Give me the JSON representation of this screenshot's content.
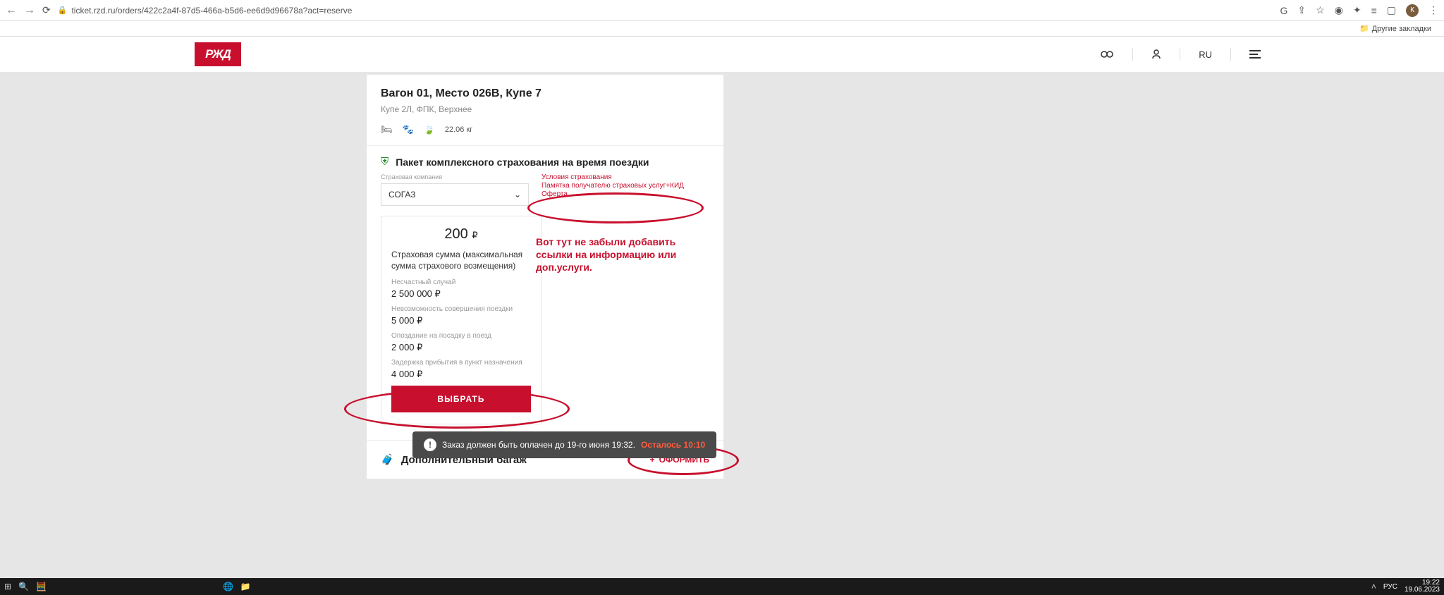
{
  "browser": {
    "url": "ticket.rzd.ru/orders/422c2a4f-87d5-466a-b5d6-ee6d9d96678a?act=reserve",
    "bookmarks_label": "Другие закладки",
    "avatar_letter": "К"
  },
  "header": {
    "logo": "РЖД",
    "lang": "RU"
  },
  "seat": {
    "title": "Вагон 01, Место 026В, Купе 7",
    "subtitle": "Купе 2Л, ФПК, Верхнее",
    "weight": "22.06 кг"
  },
  "insurance": {
    "section_title": "Пакет комплексного страхования на время поездки",
    "company_label": "Страховая компания",
    "company_value": "СОГАЗ",
    "links": {
      "l1": "Условия страхования",
      "l2": "Памятка получателю страховых услуг+КИД",
      "l3": "Оферта"
    },
    "plan": {
      "price": "200",
      "currency": "₽",
      "desc": "Страховая сумма (максимальная сумма страхового возмещения)",
      "accident_lbl": "Несчастный случай",
      "accident_val": "2 500 000 ₽",
      "cancel_lbl": "Невозможность совершения поездки",
      "cancel_val": "5 000 ₽",
      "late_lbl": "Опоздание на посадку в поезд",
      "late_val": "2 000 ₽",
      "delay_lbl": "Задержка прибытия в пункт назначения",
      "delay_val": "4 000 ₽",
      "button": "ВЫБРАТЬ"
    }
  },
  "baggage": {
    "title": "Дополнительный багаж",
    "button": "ОФОРМИТЬ"
  },
  "toast": {
    "text": "Заказ должен быть оплачен до 19-го июня 19:32.",
    "remain": "Осталось 10:10"
  },
  "annotation": {
    "text": "Вот тут не забыли добавить ссылки на информацию или доп.услуги."
  },
  "taskbar": {
    "lang": "РУС",
    "time": "19:22",
    "date": "19.06.2023"
  }
}
